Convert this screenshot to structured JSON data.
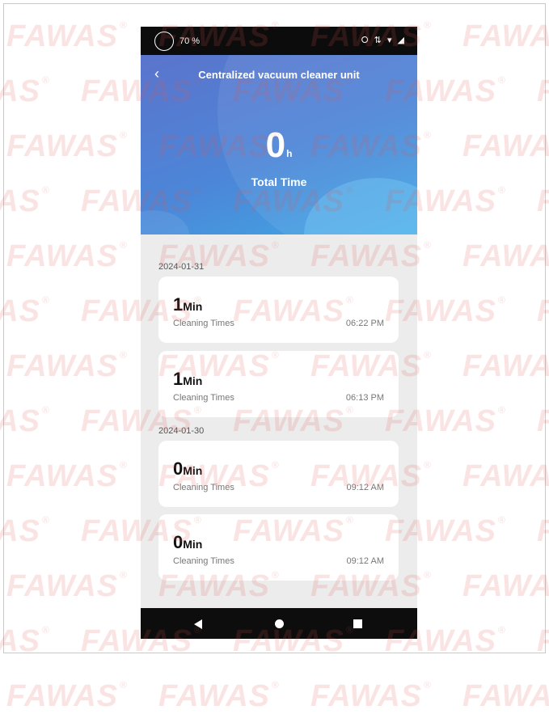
{
  "watermark": {
    "text": "FAWAS",
    "mark": "®"
  },
  "status_bar": {
    "battery": "70 %",
    "icons": [
      "vibrate-icon",
      "data-icon",
      "wifi-icon",
      "signal-icon"
    ]
  },
  "header": {
    "title": "Centralized vacuum cleaner unit",
    "back_icon": "back-arrow-icon",
    "total_value": "0",
    "total_unit": "h",
    "total_label": "Total Time"
  },
  "records": [
    {
      "date": "2024-01-31",
      "entries": [
        {
          "duration": "1",
          "unit": "Min",
          "label": "Cleaning Times",
          "time": "06:22 PM"
        },
        {
          "duration": "1",
          "unit": "Min",
          "label": "Cleaning Times",
          "time": "06:13 PM"
        }
      ]
    },
    {
      "date": "2024-01-30",
      "entries": [
        {
          "duration": "0",
          "unit": "Min",
          "label": "Cleaning Times",
          "time": "09:12 AM"
        },
        {
          "duration": "0",
          "unit": "Min",
          "label": "Cleaning Times",
          "time": "09:12 AM"
        }
      ]
    }
  ],
  "nav_bar": {
    "icons": [
      "back-triangle-icon",
      "home-circle-icon",
      "recent-square-icon"
    ]
  },
  "colors": {
    "header_start": "#5b74cc",
    "header_end": "#40a9e5",
    "watermark": "#e25a50",
    "card": "#ffffff",
    "background": "#ececec"
  }
}
